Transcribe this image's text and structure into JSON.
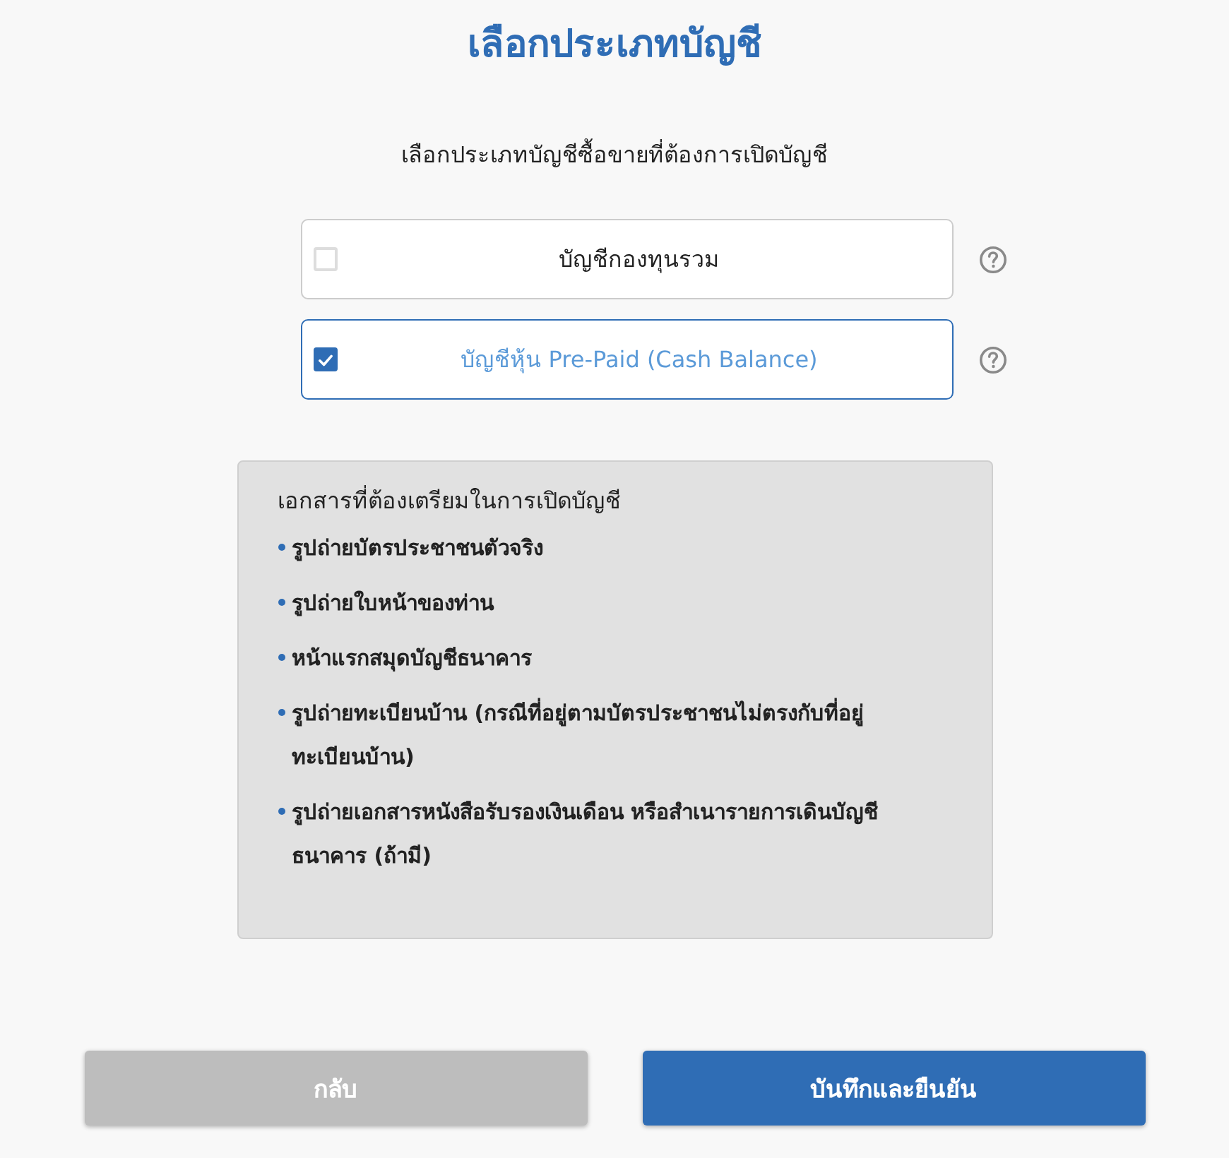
{
  "title": "เลือกประเภทบัญชี",
  "subtitle": "เลือกประเภทบัญชีซื้อขายที่ต้องการเปิดบัญชี",
  "options": [
    {
      "label": "บัญชีกองทุนรวม",
      "selected": false
    },
    {
      "label": "บัญชีหุ้น Pre-Paid (Cash Balance)",
      "selected": true
    }
  ],
  "documents": {
    "heading": "เอกสารที่ต้องเตรียมในการเปิดบัญชี",
    "items": [
      "รูปถ่ายบัตรประชาชนตัวจริง",
      "รูปถ่ายใบหน้าของท่าน",
      "หน้าแรกสมุดบัญชีธนาคาร",
      "รูปถ่ายทะเบียนบ้าน (กรณีที่อยู่ตามบัตรประชาชนไม่ตรงกับที่อยู่ทะเบียนบ้าน)",
      "รูปถ่ายเอกสารหนังสือรับรองเงินเดือน หรือสำเนารายการเดินบัญชีธนาคาร (ถ้ามี)"
    ]
  },
  "buttons": [
    {
      "label": "กลับ",
      "kind": "secondary"
    },
    {
      "label": "บันทึกและยืนยัน",
      "kind": "primary"
    }
  ]
}
